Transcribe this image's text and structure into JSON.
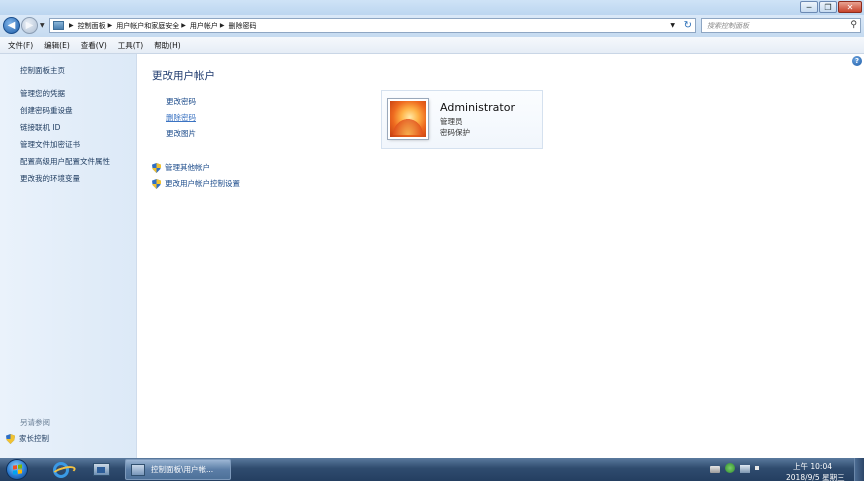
{
  "window": {
    "min_symbol": "─",
    "max_symbol": "❐",
    "close_symbol": "✕"
  },
  "address": {
    "breadcrumbs": [
      "控制面板",
      "用户帐户和家庭安全",
      "用户帐户",
      "删除密码"
    ],
    "search_placeholder": "搜索控制面板"
  },
  "menu": [
    "文件(F)",
    "编辑(E)",
    "查看(V)",
    "工具(T)",
    "帮助(H)"
  ],
  "sidebar": {
    "home": "控制面板主页",
    "items": [
      "管理您的凭据",
      "创建密码重设盘",
      "链接联机 ID",
      "管理文件加密证书",
      "配置高级用户配置文件属性",
      "更改我的环境变量"
    ],
    "see_also": "另请参阅",
    "family_safety": "家长控制"
  },
  "main": {
    "title": "更改用户帐户",
    "links": [
      "更改密码",
      "删除密码",
      "更改图片"
    ],
    "shield_links": [
      "管理其他帐户",
      "更改用户帐户控制设置"
    ],
    "user": {
      "name": "Administrator",
      "role": "管理员",
      "status": "密码保护"
    }
  },
  "taskbar": {
    "active_task": "控制面板\\用户帐...",
    "time": "上午 10:04",
    "date": "2018/9/5 星期三"
  },
  "colors": {
    "link": "#1a4a8a",
    "title": "#1e3a6e",
    "sidebar_bg": "#dce9f7",
    "taskbar_bg": "#2f4b6e"
  }
}
